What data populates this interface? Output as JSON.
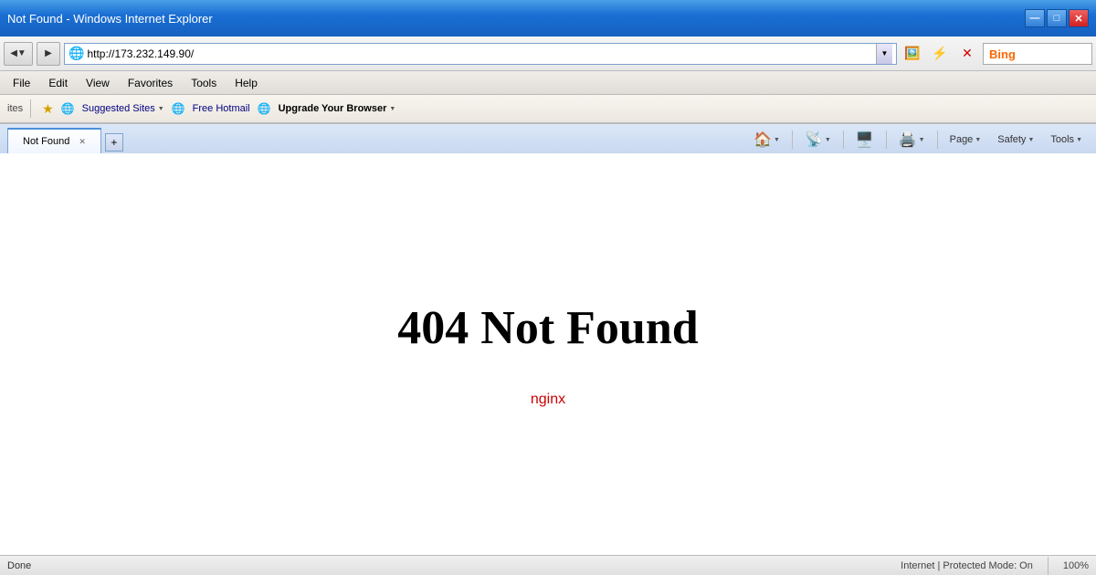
{
  "window": {
    "title": "Not Found - Windows Internet Explorer",
    "controls": {
      "minimize": "—",
      "maximize": "□",
      "close": "✕"
    }
  },
  "address_bar": {
    "url": "http://173.232.149.90/",
    "dropdown_arrow": "▼"
  },
  "bing": {
    "label": "Bing"
  },
  "menu": {
    "items": [
      "File",
      "Edit",
      "View",
      "Favorites",
      "Tools",
      "Help"
    ]
  },
  "links_bar": {
    "label": "ites",
    "suggested_sites": "Suggested Sites",
    "free_hotmail": "Free Hotmail",
    "upgrade_browser": "Upgrade Your Browser"
  },
  "tabs": [
    {
      "label": "Not Found",
      "active": true
    }
  ],
  "toolbar": {
    "home": "Home",
    "feeds": "Feeds",
    "read_mail": "Read Mail",
    "print": "Print",
    "page": "Page",
    "safety": "Safety",
    "tools": "Tools"
  },
  "content": {
    "heading": "404 Not Found",
    "subtext": "nginx"
  },
  "status": {
    "text": "Done",
    "zone": "Internet | Protected Mode: On",
    "zoom": "100%"
  }
}
